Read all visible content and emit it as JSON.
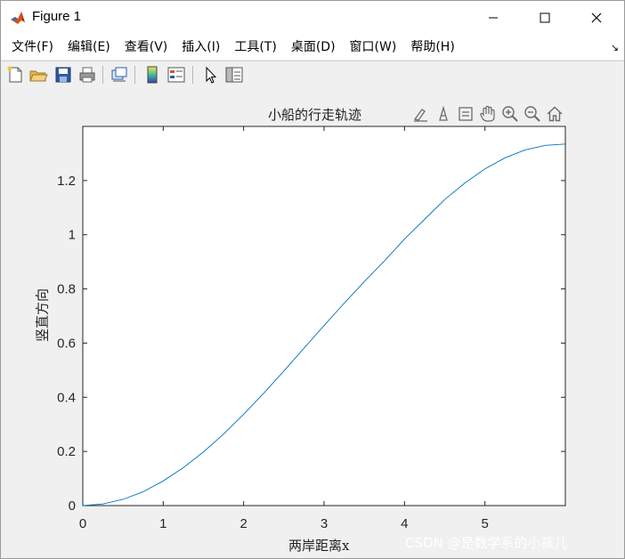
{
  "window": {
    "title": "Figure 1"
  },
  "menu": [
    {
      "label": "文件(F)"
    },
    {
      "label": "编辑(E)"
    },
    {
      "label": "查看(V)"
    },
    {
      "label": "插入(I)"
    },
    {
      "label": "工具(T)"
    },
    {
      "label": "桌面(D)"
    },
    {
      "label": "窗口(W)"
    },
    {
      "label": "帮助(H)"
    }
  ],
  "menu_overflow_icon": "menu-arrow-icon",
  "toolbar_icons": [
    "new-figure-icon",
    "open-file-icon",
    "save-icon",
    "print-icon",
    "link-plot-icon",
    "insert-colorbar-icon",
    "insert-legend-icon",
    "edit-plot-icon",
    "property-inspector-icon"
  ],
  "axes_toolbar_icons": [
    "brush-icon",
    "data-tips-icon",
    "rotate-icon",
    "pan-icon",
    "zoom-in-icon",
    "zoom-out-icon",
    "home-icon"
  ],
  "watermark": "CSDN @是数学系的小孩儿",
  "chart_data": {
    "type": "line",
    "title": "小船的行走轨迹",
    "xlabel": "两岸距离x",
    "ylabel": "竖直方向",
    "xlim": [
      0,
      6
    ],
    "ylim": [
      0,
      1.4
    ],
    "xticks": [
      "0",
      "1",
      "2",
      "3",
      "4",
      "5"
    ],
    "yticks": [
      "0",
      "0.2",
      "0.4",
      "0.6",
      "0.8",
      "1",
      "1.2"
    ],
    "grid": false,
    "line_color": "#0072BD",
    "series": [
      {
        "x": [
          0,
          0.25,
          0.5,
          0.75,
          1.0,
          1.25,
          1.5,
          1.75,
          2.0,
          2.25,
          2.5,
          2.75,
          3.0,
          3.25,
          3.5,
          3.75,
          4.0,
          4.25,
          4.5,
          4.75,
          5.0,
          5.25,
          5.5,
          5.75,
          6.0
        ],
        "y": [
          0,
          0.006,
          0.023,
          0.051,
          0.091,
          0.14,
          0.198,
          0.264,
          0.337,
          0.415,
          0.497,
          0.581,
          0.665,
          0.747,
          0.827,
          0.903,
          0.984,
          1.057,
          1.13,
          1.191,
          1.243,
          1.284,
          1.313,
          1.33,
          1.335
        ]
      }
    ]
  }
}
